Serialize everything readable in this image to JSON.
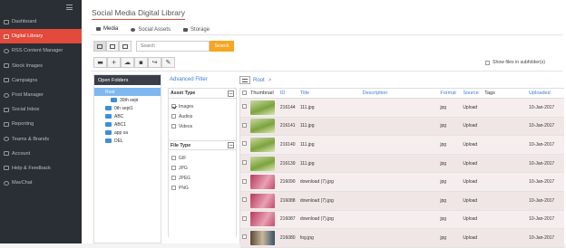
{
  "sidebar": {
    "items": [
      {
        "label": "Dashboard",
        "icon": "dashboard-icon"
      },
      {
        "label": "Digital Library",
        "icon": "library-icon",
        "active": true
      },
      {
        "label": "RSS Content Manager",
        "icon": "rss-icon"
      },
      {
        "label": "Stock Images",
        "icon": "image-icon"
      },
      {
        "label": "Campaigns",
        "icon": "campaign-icon"
      },
      {
        "label": "Post Manager",
        "icon": "post-icon"
      },
      {
        "label": "Social Inbox",
        "icon": "inbox-icon"
      },
      {
        "label": "Reporting",
        "icon": "chart-icon"
      },
      {
        "label": "Teams & Brands",
        "icon": "team-icon"
      },
      {
        "label": "Account",
        "icon": "gear-icon"
      },
      {
        "label": "Help & Feedback",
        "icon": "help-icon"
      },
      {
        "label": "MavChat",
        "icon": "chat-icon"
      }
    ]
  },
  "page": {
    "title": "Social Media Digital Library"
  },
  "tabs": [
    {
      "label": "Media",
      "active": true
    },
    {
      "label": "Social Assets",
      "active": false
    },
    {
      "label": "Storage",
      "active": false
    }
  ],
  "search": {
    "placeholder": "Search",
    "button": "Search"
  },
  "toolbar": {
    "show_subfolders": "Show files in subfolder(s)"
  },
  "folders": {
    "header": "Open Folders",
    "root": "Root",
    "items": [
      "30th sept",
      "0th sept1",
      "ABC",
      "ABC1",
      "app sa",
      "DEL"
    ]
  },
  "filter": {
    "link": "Advanced Filter",
    "asset_type": {
      "title": "Asset Type",
      "options": [
        {
          "label": "Images",
          "checked": true
        },
        {
          "label": "Audios",
          "checked": false
        },
        {
          "label": "Videos",
          "checked": false
        }
      ]
    },
    "file_type": {
      "title": "File Type",
      "options": [
        "GIF",
        "JPG",
        "JPEG",
        "PNG"
      ]
    }
  },
  "breadcrumb": {
    "root": "Root",
    "separator": ">"
  },
  "grid": {
    "columns": [
      "Thumbnail",
      "ID",
      "Title",
      "Description",
      "Format",
      "Source",
      "Tags",
      "Uploaded"
    ],
    "rows": [
      {
        "id": "216144",
        "title": "111.jpg",
        "format": "jpg",
        "source": "Upload",
        "uploaded": "10-Jan-2017",
        "thumb": "green"
      },
      {
        "id": "216141",
        "title": "111.jpg",
        "format": "jpg",
        "source": "Upload",
        "uploaded": "10-Jan-2017",
        "thumb": "green"
      },
      {
        "id": "216140",
        "title": "111.jpg",
        "format": "jpg",
        "source": "Upload",
        "uploaded": "10-Jan-2017",
        "thumb": "green"
      },
      {
        "id": "216139",
        "title": "111.jpg",
        "format": "jpg",
        "source": "Upload",
        "uploaded": "10-Jan-2017",
        "thumb": "green"
      },
      {
        "id": "216090",
        "title": "download (7).jpg",
        "format": "jpg",
        "source": "Upload",
        "uploaded": "10-Jan-2017",
        "thumb": "red"
      },
      {
        "id": "216088",
        "title": "download (7).jpg",
        "format": "jpg",
        "source": "Upload",
        "uploaded": "10-Jan-2017",
        "thumb": "red"
      },
      {
        "id": "216087",
        "title": "download (7).jpg",
        "format": "jpg",
        "source": "Upload",
        "uploaded": "10-Jan-2017",
        "thumb": "red"
      },
      {
        "id": "216080",
        "title": "fog.jpg",
        "format": "jpg",
        "source": "Upload",
        "uploaded": "10-Jan-2017",
        "thumb": "mixed"
      }
    ]
  },
  "colors": {
    "accent": "#e24a3b",
    "sidebar_bg": "#2a2e35",
    "link": "#3b7dd8",
    "search_button": "#f5a623"
  }
}
